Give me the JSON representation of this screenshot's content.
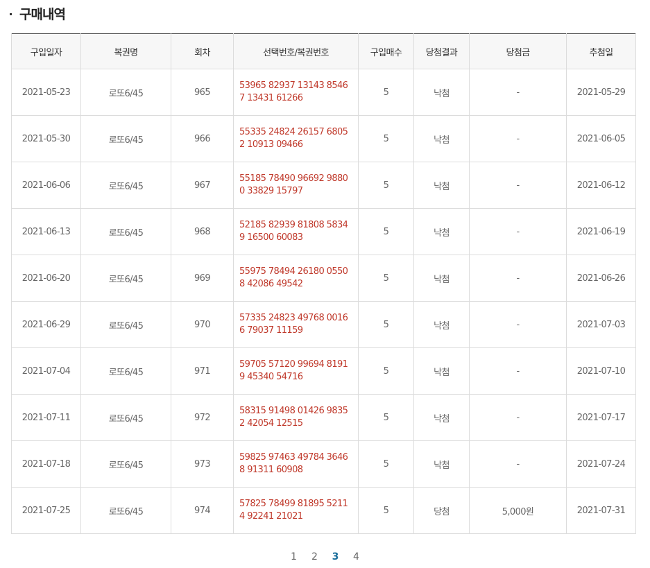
{
  "title": "구매내역",
  "columns": [
    "구입일자",
    "복권명",
    "회차",
    "선택번호/복권번호",
    "구입매수",
    "당첨결과",
    "당첨금",
    "추첨일"
  ],
  "rows": [
    {
      "date": "2021-05-23",
      "name": "로또6/45",
      "round": "965",
      "numbers": "53965 82937 13143 85467 13431 61266",
      "qty": "5",
      "result": "낙첨",
      "prize": "-",
      "draw": "2021-05-29"
    },
    {
      "date": "2021-05-30",
      "name": "로또6/45",
      "round": "966",
      "numbers": "55335 24824 26157 68052 10913 09466",
      "qty": "5",
      "result": "낙첨",
      "prize": "-",
      "draw": "2021-06-05"
    },
    {
      "date": "2021-06-06",
      "name": "로또6/45",
      "round": "967",
      "numbers": "55185 78490 96692 98800 33829 15797",
      "qty": "5",
      "result": "낙첨",
      "prize": "-",
      "draw": "2021-06-12"
    },
    {
      "date": "2021-06-13",
      "name": "로또6/45",
      "round": "968",
      "numbers": "52185 82939 81808 58349 16500 60083",
      "qty": "5",
      "result": "낙첨",
      "prize": "-",
      "draw": "2021-06-19"
    },
    {
      "date": "2021-06-20",
      "name": "로또6/45",
      "round": "969",
      "numbers": "55975 78494 26180 05508 42086 49542",
      "qty": "5",
      "result": "낙첨",
      "prize": "-",
      "draw": "2021-06-26"
    },
    {
      "date": "2021-06-29",
      "name": "로또6/45",
      "round": "970",
      "numbers": "57335 24823 49768 00166 79037 11159",
      "qty": "5",
      "result": "낙첨",
      "prize": "-",
      "draw": "2021-07-03"
    },
    {
      "date": "2021-07-04",
      "name": "로또6/45",
      "round": "971",
      "numbers": "59705 57120 99694 81919 45340 54716",
      "qty": "5",
      "result": "낙첨",
      "prize": "-",
      "draw": "2021-07-10"
    },
    {
      "date": "2021-07-11",
      "name": "로또6/45",
      "round": "972",
      "numbers": "58315 91498 01426 98352 42054 12515",
      "qty": "5",
      "result": "낙첨",
      "prize": "-",
      "draw": "2021-07-17"
    },
    {
      "date": "2021-07-18",
      "name": "로또6/45",
      "round": "973",
      "numbers": "59825 97463 49784 36468 91311 60908",
      "qty": "5",
      "result": "낙첨",
      "prize": "-",
      "draw": "2021-07-24"
    },
    {
      "date": "2021-07-25",
      "name": "로또6/45",
      "round": "974",
      "numbers": "57825 78499 81895 52114 92241 21021",
      "qty": "5",
      "result": "당첨",
      "prize": "5,000원",
      "draw": "2021-07-31"
    }
  ],
  "pagination": {
    "pages": [
      "1",
      "2",
      "3",
      "4"
    ],
    "current": "3"
  },
  "colors": {
    "numbers": "#c0392b",
    "active_page": "#1a6e9b",
    "header_bg": "#f7f7f7"
  }
}
